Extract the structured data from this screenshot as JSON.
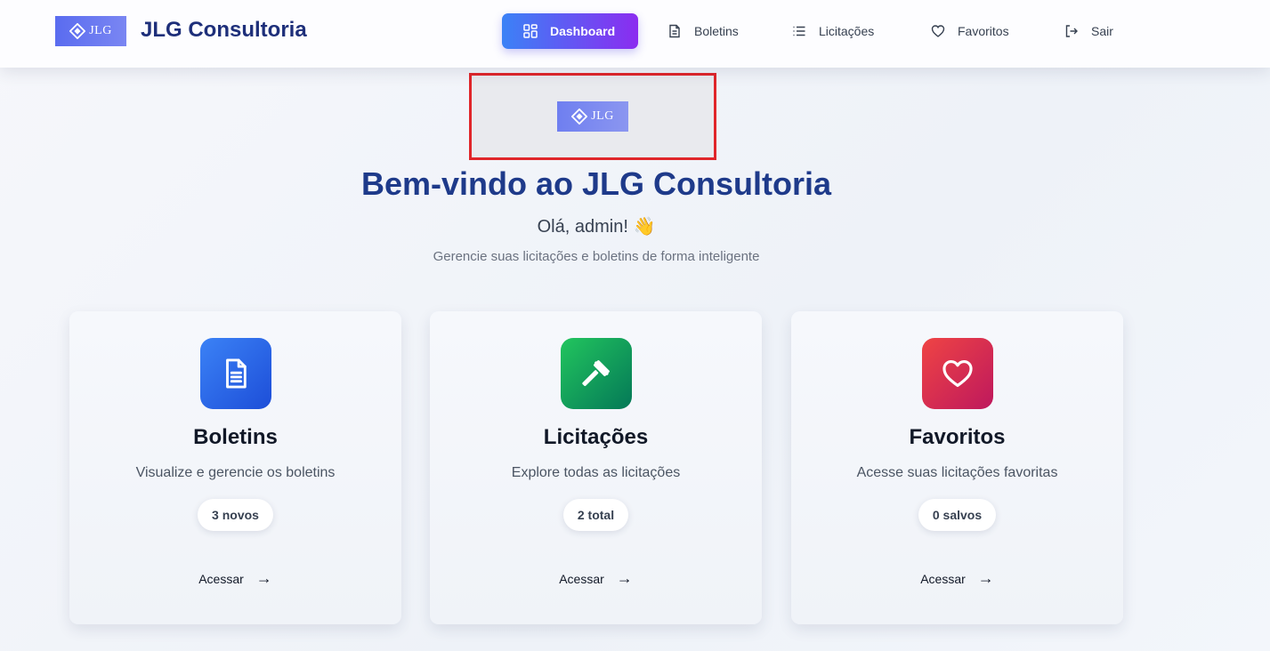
{
  "header": {
    "logo_text": "JLG",
    "brand_name": "JLG Consultoria",
    "nav": [
      {
        "label": "Dashboard",
        "icon": "dashboard-grid-icon",
        "active": true
      },
      {
        "label": "Boletins",
        "icon": "document-icon",
        "active": false
      },
      {
        "label": "Licitações",
        "icon": "list-icon",
        "active": false
      },
      {
        "label": "Favoritos",
        "icon": "heart-icon",
        "active": false
      },
      {
        "label": "Sair",
        "icon": "logout-icon",
        "active": false
      }
    ]
  },
  "hero": {
    "logo_text": "JLG",
    "title": "Bem-vindo ao JLG Consultoria",
    "greeting": "Olá, admin! 👋",
    "subtitle": "Gerencie suas licitações e boletins de forma inteligente"
  },
  "cards": [
    {
      "title": "Boletins",
      "description": "Visualize e gerencie os boletins",
      "badge": "3 novos",
      "link_label": "Acessar",
      "link_arrow": "→",
      "icon": "document-icon",
      "color_from": "#3b82f6",
      "color_to": "#1d4ed8"
    },
    {
      "title": "Licitações",
      "description": "Explore todas as licitações",
      "badge": "2 total",
      "link_label": "Acessar",
      "link_arrow": "→",
      "icon": "gavel-icon",
      "color_from": "#22c55e",
      "color_to": "#047857"
    },
    {
      "title": "Favoritos",
      "description": "Acesse suas licitações favoritas",
      "badge": "0 salvos",
      "link_label": "Acessar",
      "link_arrow": "→",
      "icon": "heart-icon",
      "color_from": "#ef4444",
      "color_to": "#be185d"
    }
  ],
  "colors": {
    "brand": "#1e3a8a",
    "nav_active_from": "#3b82f6",
    "nav_active_to": "#8b2cf0",
    "highlight_border": "#e0262a"
  }
}
